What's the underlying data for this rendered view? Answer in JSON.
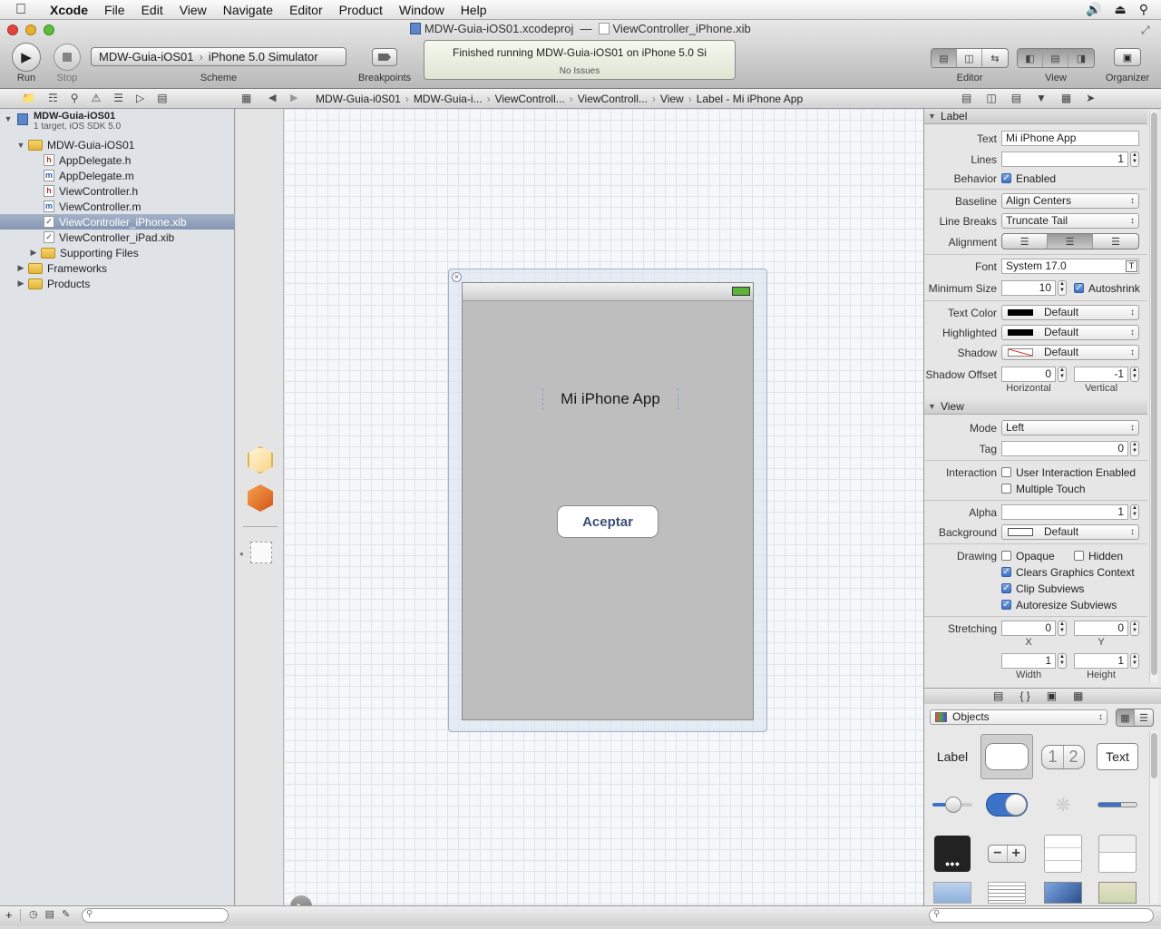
{
  "menubar": {
    "app": "Xcode",
    "items": [
      "File",
      "Edit",
      "View",
      "Navigate",
      "Editor",
      "Product",
      "Window",
      "Help"
    ]
  },
  "window": {
    "title_project": "MDW-Guia-iOS01.xcodeproj",
    "title_sep": "—",
    "title_file": "ViewController_iPhone.xib"
  },
  "toolbar": {
    "run_label": "Run",
    "stop_label": "Stop",
    "scheme_target": "MDW-Guia-iOS01",
    "scheme_device": "iPhone 5.0 Simulator",
    "scheme_label": "Scheme",
    "breakpoints_label": "Breakpoints",
    "status_text": "Finished running MDW-Guia-iOS01 on iPhone 5.0 Si",
    "status_sub": "No Issues",
    "editor_label": "Editor",
    "view_label": "View",
    "organizer_label": "Organizer"
  },
  "breadcrumbs": [
    "MDW-Guia-i0S01",
    "MDW-Guia-i...",
    "ViewControll...",
    "ViewControll...",
    "View",
    "Label - Mi iPhone App"
  ],
  "navigator": {
    "project_name": "MDW-Guia-iOS01",
    "project_sub": "1 target, iOS SDK 5.0",
    "items": [
      {
        "label": "MDW-Guia-iOS01",
        "kind": "folder"
      },
      {
        "label": "AppDelegate.h",
        "kind": "h"
      },
      {
        "label": "AppDelegate.m",
        "kind": "m"
      },
      {
        "label": "ViewController.h",
        "kind": "h"
      },
      {
        "label": "ViewController.m",
        "kind": "m"
      },
      {
        "label": "ViewController_iPhone.xib",
        "kind": "xib"
      },
      {
        "label": "ViewController_iPad.xib",
        "kind": "xib"
      },
      {
        "label": "Supporting Files",
        "kind": "folder"
      },
      {
        "label": "Frameworks",
        "kind": "folder"
      },
      {
        "label": "Products",
        "kind": "folder"
      }
    ]
  },
  "canvas": {
    "label_text": "Mi iPhone App",
    "button_text": "Aceptar"
  },
  "inspector": {
    "label_section": "Label",
    "text_label": "Text",
    "text_value": "Mi iPhone App",
    "lines_label": "Lines",
    "lines_value": "1",
    "behavior_label": "Behavior",
    "enabled_label": "Enabled",
    "baseline_label": "Baseline",
    "baseline_value": "Align Centers",
    "linebreaks_label": "Line Breaks",
    "linebreaks_value": "Truncate Tail",
    "alignment_label": "Alignment",
    "font_label": "Font",
    "font_value": "System 17.0",
    "minsize_label": "Minimum Size",
    "minsize_value": "10",
    "autoshrink_label": "Autoshrink",
    "textcolor_label": "Text Color",
    "textcolor_value": "Default",
    "highlighted_label": "Highlighted",
    "highlighted_value": "Default",
    "shadow_label": "Shadow",
    "shadow_value": "Default",
    "shadowoffset_label": "Shadow Offset",
    "shadow_h": "0",
    "shadow_v": "-1",
    "horizontal_label": "Horizontal",
    "vertical_label": "Vertical",
    "view_section": "View",
    "mode_label": "Mode",
    "mode_value": "Left",
    "tag_label": "Tag",
    "tag_value": "0",
    "interaction_label": "Interaction",
    "uie_label": "User Interaction Enabled",
    "mt_label": "Multiple Touch",
    "alpha_label": "Alpha",
    "alpha_value": "1",
    "background_label": "Background",
    "background_value": "Default",
    "drawing_label": "Drawing",
    "opaque_label": "Opaque",
    "hidden_label": "Hidden",
    "cgc_label": "Clears Graphics Context",
    "clip_label": "Clip Subviews",
    "autoresize_label": "Autoresize Subviews",
    "stretching_label": "Stretching",
    "stretch_x": "0",
    "stretch_y": "0",
    "stretch_w": "1",
    "stretch_h": "1",
    "x_label": "X",
    "y_label": "Y",
    "width_label": "Width",
    "height_label": "Height"
  },
  "library": {
    "selector": "Objects",
    "tile_label": "Label",
    "tile_seg_1": "1",
    "tile_seg_2": "2",
    "tile_text": "Text"
  }
}
